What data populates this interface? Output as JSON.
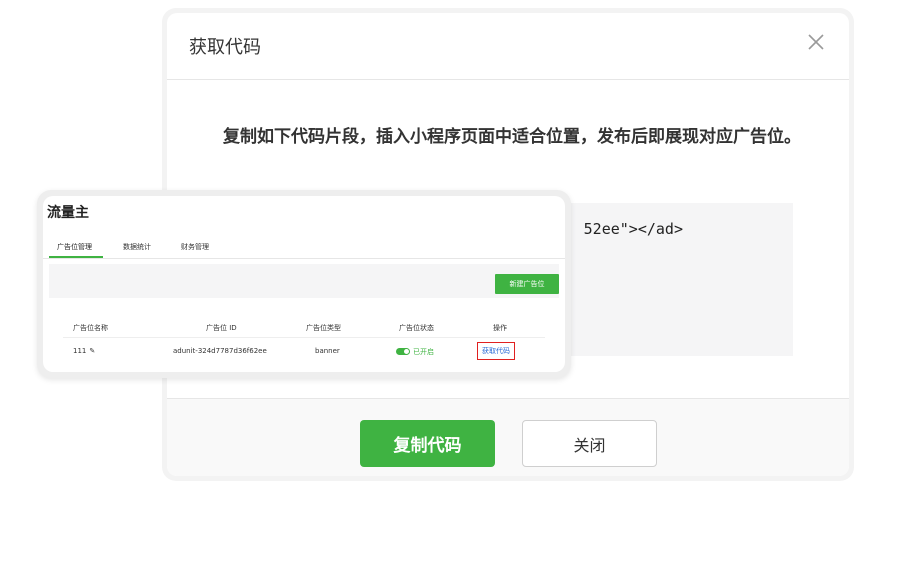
{
  "dialog": {
    "title": "获取代码",
    "description": "复制如下代码片段，插入小程序页面中适合位置，发布后即展现对应广告位。",
    "code_snippet": "52ee\"></ad>",
    "copy_button": "复制代码",
    "close_button": "关闭"
  },
  "mini_window": {
    "title": "流量主",
    "tabs": [
      "广告位管理",
      "数据统计",
      "财务管理"
    ],
    "new_button": "新建广告位",
    "columns": [
      "广告位名称",
      "广告位 ID",
      "广告位类型",
      "广告位状态",
      "操作"
    ],
    "row": {
      "name": "111",
      "id": "adunit-324d7787d36f62ee",
      "type": "banner",
      "status": "已开启",
      "action": "获取代码"
    }
  },
  "colors": {
    "accent": "#3fb342",
    "highlight_border": "#e02020",
    "link": "#2a6bd6"
  }
}
